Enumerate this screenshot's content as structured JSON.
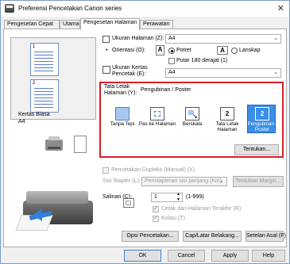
{
  "window": {
    "title": "Preferensi Pencetakan Canon            series",
    "close": "✕"
  },
  "tabs": [
    {
      "label": "Pengesetan Cepat"
    },
    {
      "label": "Utama"
    },
    {
      "label": "Pengesetan Halaman"
    },
    {
      "label": "Perawatan"
    }
  ],
  "page_size": {
    "label": "Ukuran Halaman (Z):",
    "value": "A4"
  },
  "orientation": {
    "label": "Orientasi (O):",
    "portrait": "Potret",
    "landscape": "Lanskap",
    "rotate": "Putar 180 derajat (1)"
  },
  "printer_paper_size": {
    "label": "Ukuran Kertas Pencetak (E):",
    "value": "A4"
  },
  "layout": {
    "label": "Tata Letak Halaman (Y):",
    "value": "Pengubinan / Poster",
    "options": [
      {
        "label": "Tanpa Tepi"
      },
      {
        "label": "Pas ke Halaman"
      },
      {
        "label": "Berskala"
      },
      {
        "label": "Tata Letak Halaman"
      },
      {
        "label": "Pengubinan / Poster"
      }
    ],
    "specify_button": "Tentukan..."
  },
  "preview": {
    "page1": "1",
    "page2": "2",
    "media_type": "Kertas Biasa",
    "paper": "A4"
  },
  "duplex": {
    "label": "Pencetakan Dupleks (Manual) (X)",
    "stapling_label": "Sisi Stapler (L):",
    "stapling_value": "Penstapleran sisi panjang (Kiri)",
    "margin_button": "Tentukan Margin..."
  },
  "copies": {
    "label": "Salinan (C):",
    "value": "1",
    "range": "(1-999)",
    "print_last_page": "Cetak dari Halaman Terakhir (R)",
    "collate": "Kolasi (T)"
  },
  "buttons": {
    "print_options": "Opsi Pencetakan...",
    "stamp_background": "Cap/Latar Belakang...",
    "defaults": "Setelan Asal (F)",
    "ok": "OK",
    "cancel": "Cancel",
    "apply": "Apply",
    "help": "Help"
  },
  "colors": {
    "accent": "#3a8ee6",
    "highlight_border": "#d91f26"
  }
}
